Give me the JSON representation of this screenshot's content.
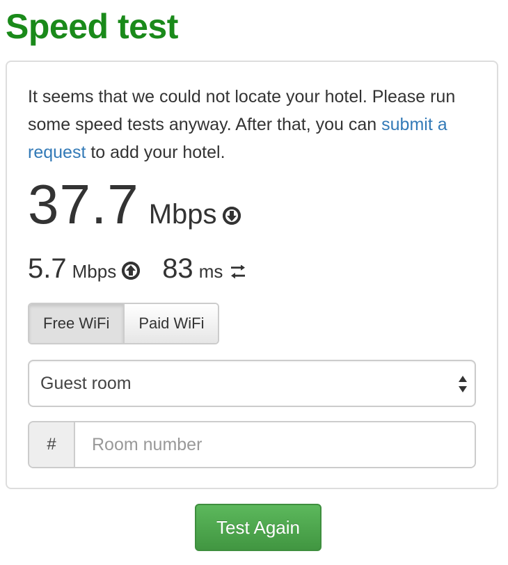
{
  "page": {
    "title": "Speed test"
  },
  "intro": {
    "text_before": "It seems that we could not locate your hotel. Please run some speed tests anyway. After that, you can ",
    "link_text": "submit a request",
    "text_after": " to add your hotel."
  },
  "results": {
    "download_value": "37.7",
    "download_unit": "Mbps",
    "download_icon": "arrow-circle-down-icon",
    "upload_value": "5.7",
    "upload_unit": "Mbps",
    "upload_icon": "arrow-circle-up-icon",
    "ping_value": "83",
    "ping_unit": "ms",
    "ping_icon": "exchange-arrows-icon"
  },
  "wifi_type": {
    "options": [
      "Free WiFi",
      "Paid WiFi"
    ],
    "selected": "Free WiFi"
  },
  "location_select": {
    "value": "Guest room"
  },
  "room_number": {
    "addon": "#",
    "placeholder": "Room number",
    "value": ""
  },
  "actions": {
    "test_again_label": "Test Again"
  },
  "colors": {
    "title": "#1a8a1a",
    "link": "#337ab7",
    "button": "#5cb85c"
  }
}
